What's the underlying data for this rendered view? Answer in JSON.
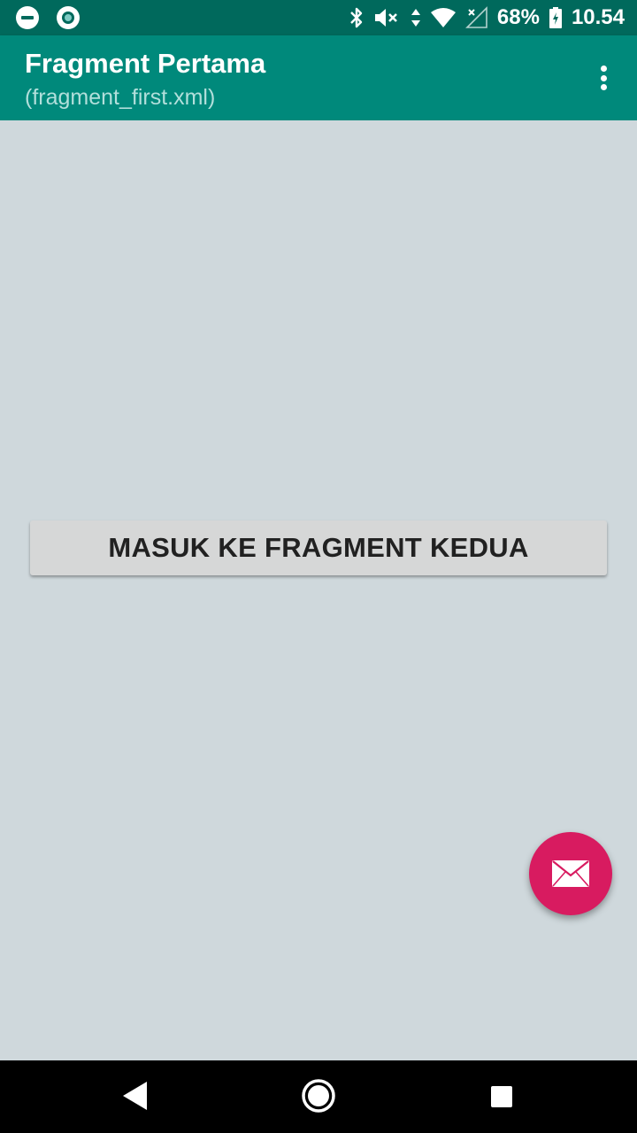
{
  "status_bar": {
    "left_icons": [
      "do-not-disturb-icon",
      "sync-icon"
    ],
    "right_icons": [
      "bluetooth-icon",
      "mute-icon",
      "data-arrows-icon",
      "wifi-icon",
      "no-signal-icon",
      "battery-charging-icon"
    ],
    "battery": "68%",
    "time": "10.54"
  },
  "app_bar": {
    "title": "Fragment Pertama",
    "subtitle": "(fragment_first.xml)",
    "overflow_icon": "more-vert-icon",
    "color": "#00897b"
  },
  "main": {
    "button_label": "MASUK KE FRAGMENT KEDUA",
    "background": "#cfd8dc"
  },
  "fab": {
    "icon": "mail-icon",
    "color": "#d81b60"
  },
  "nav_bar": {
    "buttons": [
      "back-icon",
      "home-icon",
      "recents-icon"
    ]
  }
}
